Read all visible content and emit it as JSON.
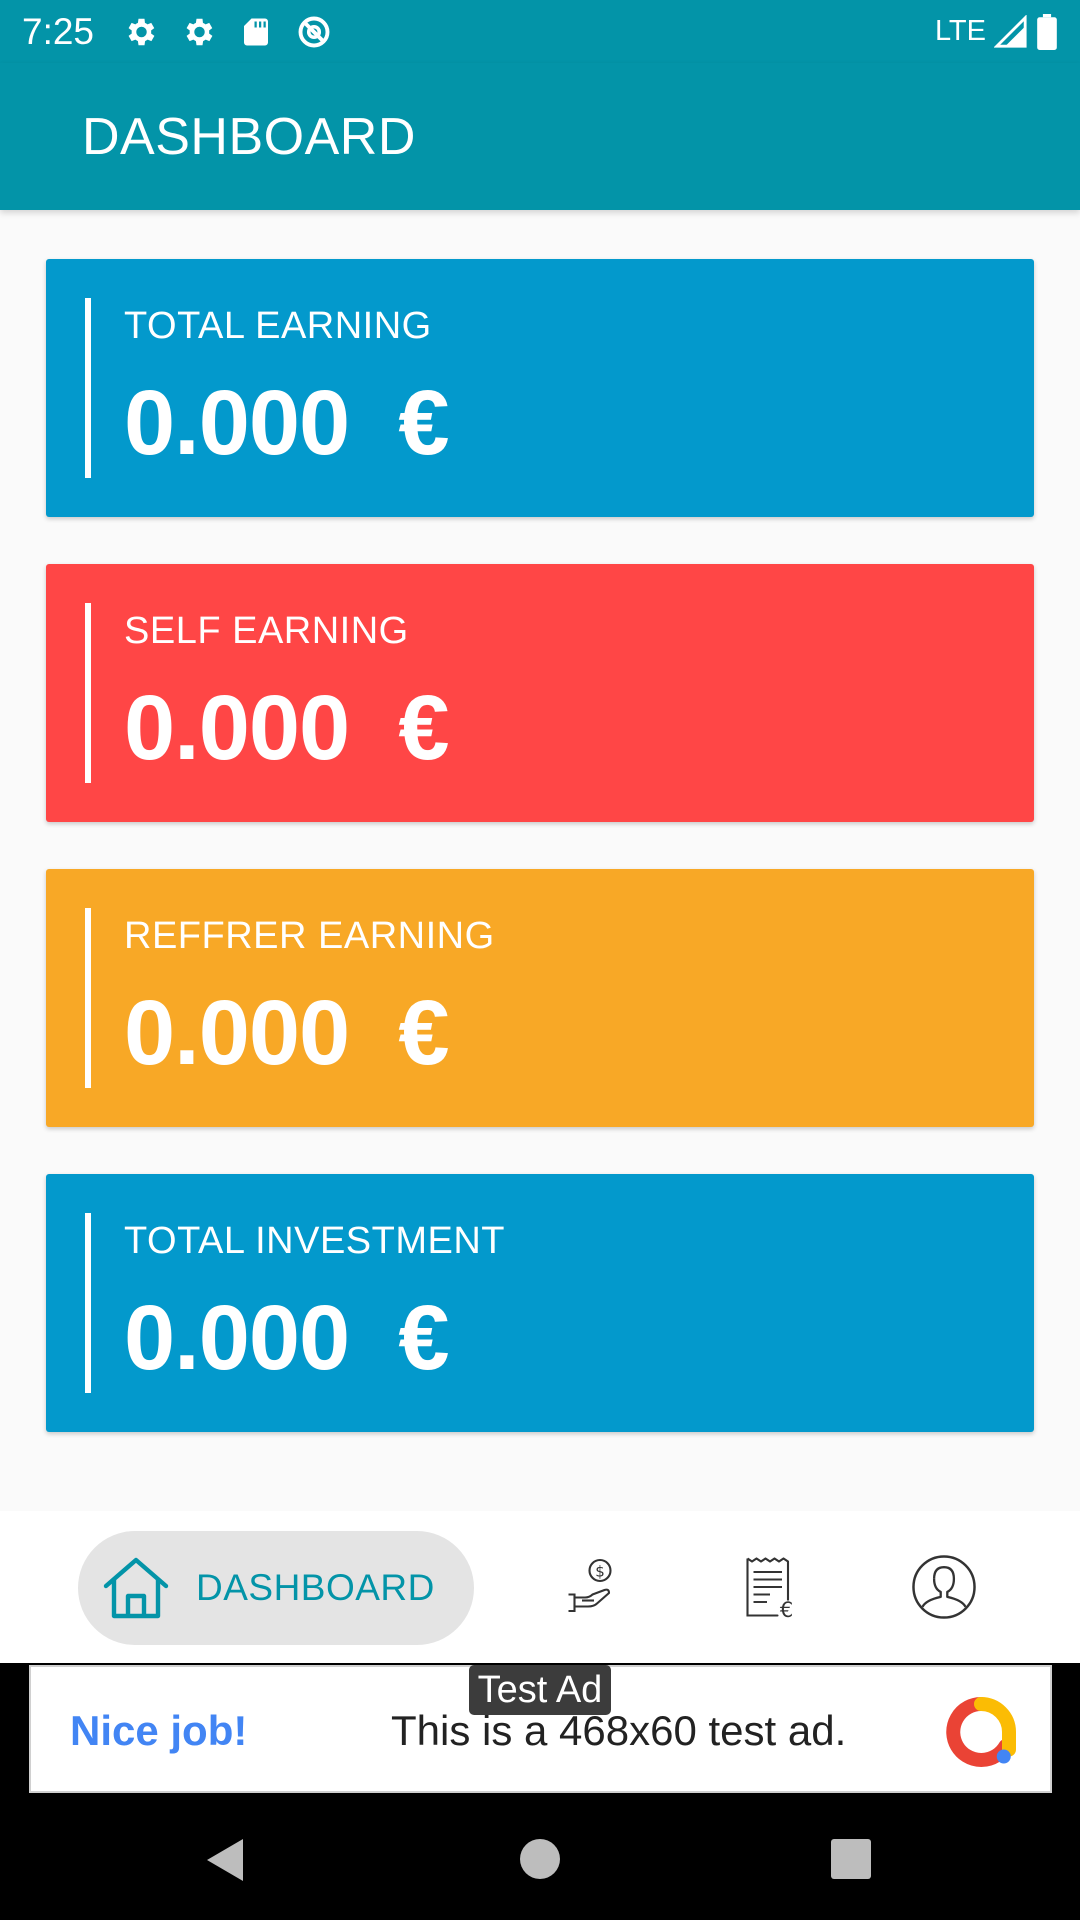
{
  "status_bar": {
    "time": "7:25",
    "network": "LTE",
    "icons": [
      "gear-icon",
      "gear-icon",
      "sd-card-icon",
      "do-not-disturb-icon",
      "signal-icon",
      "battery-icon"
    ]
  },
  "app_bar": {
    "title": "DASHBOARD"
  },
  "cards": [
    {
      "label": "TOTAL EARNING",
      "value": "0.000  €",
      "color": "#0399cc"
    },
    {
      "label": "SELF EARNING",
      "value": "0.000  €",
      "color": "#ff4646"
    },
    {
      "label": "REFFRER EARNING",
      "value": "0.000  €",
      "color": "#f8a826"
    },
    {
      "label": "TOTAL INVESTMENT",
      "value": "0.000  €",
      "color": "#0399cc"
    }
  ],
  "bottom_nav": {
    "active_label": "DASHBOARD",
    "items": [
      "home-icon",
      "invest-hand-dollar-icon",
      "invoice-euro-icon",
      "profile-icon"
    ]
  },
  "ad": {
    "tag": "Test Ad",
    "headline": "Nice job!",
    "text": "This is a 468x60 test ad."
  },
  "colors": {
    "primary": "#0394a8",
    "blue_card": "#0399cc",
    "red_card": "#ff4646",
    "orange_card": "#f8a826"
  }
}
